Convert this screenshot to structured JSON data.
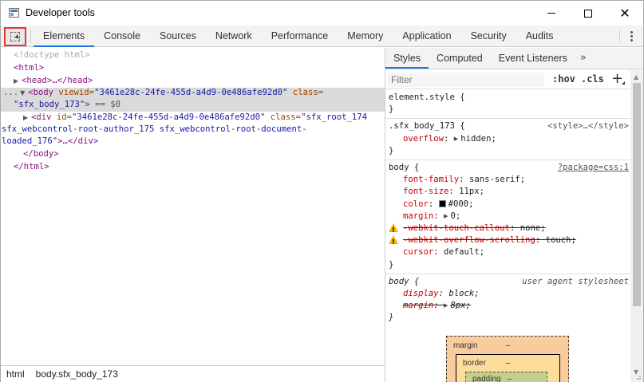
{
  "window": {
    "title": "Developer tools"
  },
  "main_tabs": {
    "items": [
      {
        "label": "Elements",
        "active": true
      },
      {
        "label": "Console"
      },
      {
        "label": "Sources"
      },
      {
        "label": "Network"
      },
      {
        "label": "Performance"
      },
      {
        "label": "Memory"
      },
      {
        "label": "Application"
      },
      {
        "label": "Security"
      },
      {
        "label": "Audits"
      }
    ]
  },
  "dom": {
    "doctype": "<!doctype html>",
    "html_open": "<html>",
    "head": "<head>…</head>",
    "body_open_a": "<body",
    "body_attr1_name": " viewid=",
    "body_attr1_value": "\"3461e28c-24fe-455d-a4d9-0e486afe92d0\"",
    "body_attr2_name": " class=",
    "body_attr2_value": "\"sfx_body_173\"",
    "body_close_bracket": ">",
    "body_eq": " == $0",
    "div_open": "<div",
    "div_id_name": " id=",
    "div_id_value": "\"3461e28c-24fe-455d-a4d9-0e486afe92d0\"",
    "div_class_name": " class=",
    "div_class_value_1": "\"sfx_root_174",
    "div_class_value_2": "sfx_webcontrol-root-author_175 sfx_webcontrol-root-document-",
    "div_class_value_3": "loaded_176\"",
    "div_tail": ">…</div>",
    "body_close": "</body>",
    "html_close": "</html>",
    "ellipsis": "..."
  },
  "breadcrumb": {
    "items": [
      "html",
      "body.sfx_body_173"
    ]
  },
  "styles_tabs": {
    "items": [
      {
        "label": "Styles",
        "active": true
      },
      {
        "label": "Computed"
      },
      {
        "label": "Event Listeners"
      }
    ],
    "more": "»"
  },
  "filter": {
    "placeholder": "Filter",
    "hov": ":hov",
    "cls": ".cls",
    "add": "+"
  },
  "rules": {
    "element_style": {
      "selector": "element.style {",
      "close": "}"
    },
    "sfx_body": {
      "selector": ".sfx_body_173 {",
      "source": "<style>…</style>",
      "decl_name": "overflow",
      "decl_value": "hidden;",
      "close": "}"
    },
    "body": {
      "selector": "body {",
      "source": "?package=css:1",
      "font_family_name": "font-family",
      "font_family_value": "sans-serif;",
      "font_size_name": "font-size",
      "font_size_value": "11px;",
      "color_name": "color",
      "color_value": "#000;",
      "margin_name": "margin",
      "margin_value": "0;",
      "callout_name": "-webkit-touch-callout",
      "callout_value": "none;",
      "overflow_scroll_name": "-webkit-overflow-scrolling",
      "overflow_scroll_value": "touch;",
      "cursor_name": "cursor",
      "cursor_value": "default;",
      "close": "}"
    },
    "ua": {
      "selector": "body {",
      "source": "user agent stylesheet",
      "display_name": "display",
      "display_value": "block;",
      "margin_name": "margin",
      "margin_value": "8px;",
      "close": "}"
    }
  },
  "box_model": {
    "margin_label": "margin",
    "margin_value": "–",
    "border_label": "border",
    "border_value": "–",
    "padding_label": "padding",
    "padding_value": "–"
  },
  "colors": {
    "accent": "#1a73e8",
    "inspect_highlight": "#e53935",
    "tag": "#881280",
    "attr_name": "#994500",
    "attr_value": "#1a1aa6",
    "prop_name": "#c80000",
    "margin_box": "#f9cc9d",
    "border_box": "#fddd9b",
    "padding_box": "#c3d08b"
  }
}
